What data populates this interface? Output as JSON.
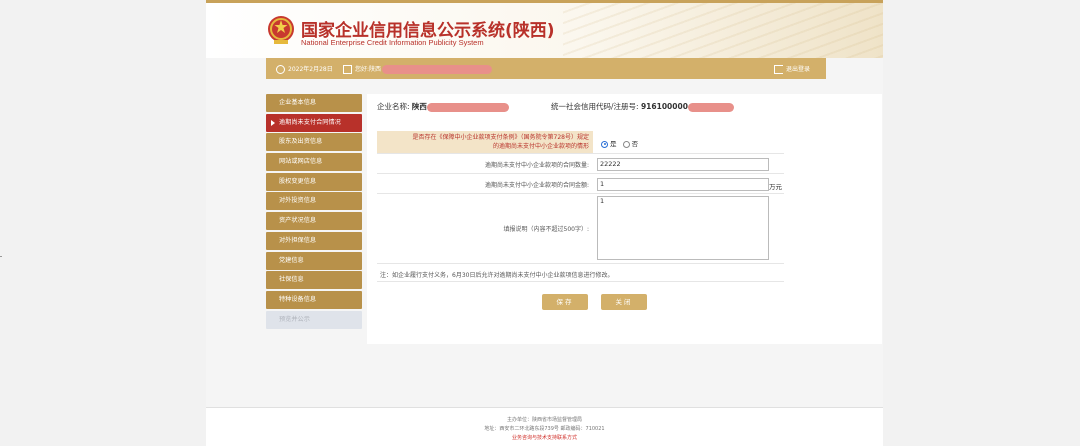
{
  "header": {
    "title_cn": "国家企业信用信息公示系统(陕西)",
    "title_en": "National Enterprise Credit Information Publicity System"
  },
  "infobar": {
    "date": "2022年2月28日",
    "user_prefix": "您好:",
    "user_name": "陕西",
    "logout": "退出登录"
  },
  "sidebar": {
    "items": [
      {
        "label": "企业基本信息",
        "state": "normal"
      },
      {
        "label": "逾期尚未支付合同情况",
        "state": "active"
      },
      {
        "label": "股东及出资信息",
        "state": "normal"
      },
      {
        "label": "网站或网店信息",
        "state": "normal"
      },
      {
        "label": "股权变更信息",
        "state": "normal"
      },
      {
        "label": "对外投资信息",
        "state": "normal"
      },
      {
        "label": "资产状况信息",
        "state": "normal"
      },
      {
        "label": "对外担保信息",
        "state": "normal"
      },
      {
        "label": "党建信息",
        "state": "normal"
      },
      {
        "label": "社保信息",
        "state": "normal"
      },
      {
        "label": "特种设备信息",
        "state": "normal"
      },
      {
        "label": "预览并公示",
        "state": "disabled"
      }
    ]
  },
  "corp": {
    "name_label": "企业名称:",
    "name_value": "陕西",
    "code_label": "统一社会信用代码/注册号:",
    "code_value": "916100000"
  },
  "form": {
    "q1_label_line1": "是否存在《保障中小企业款项支付条例》（国务院令第728号）规定",
    "q1_label_line2": "的逾期尚未支付中小企业款项的情形",
    "q1_yes": "是",
    "q1_no": "否",
    "q1_selected": "是",
    "q2_label": "逾期尚未支付中小企业款项的合同数量:",
    "q2_value": "22222",
    "q3_label": "逾期尚未支付中小企业款项的合同金额:",
    "q3_value": "1",
    "q3_unit": "万元",
    "q4_label": "填报说明（内容不超过500字）:",
    "q4_value": "1",
    "note": "注：如企业履行支付义务，6月30日后允许对逾期尚未支付中小企业款项信息进行修改。"
  },
  "buttons": {
    "save": "保存",
    "close": "关闭"
  },
  "footer": {
    "line1": "主办单位：陕西省市场监督管理局",
    "line2": "地址：西安市二环北路东段739号   邮政编码：710021",
    "line3": "业务咨询与技术支持联系方式"
  },
  "colors": {
    "accent_gold": "#d3b06a",
    "sidebar_gold": "#b8914a",
    "brand_red": "#b8312a",
    "redaction": "#e8908a"
  }
}
